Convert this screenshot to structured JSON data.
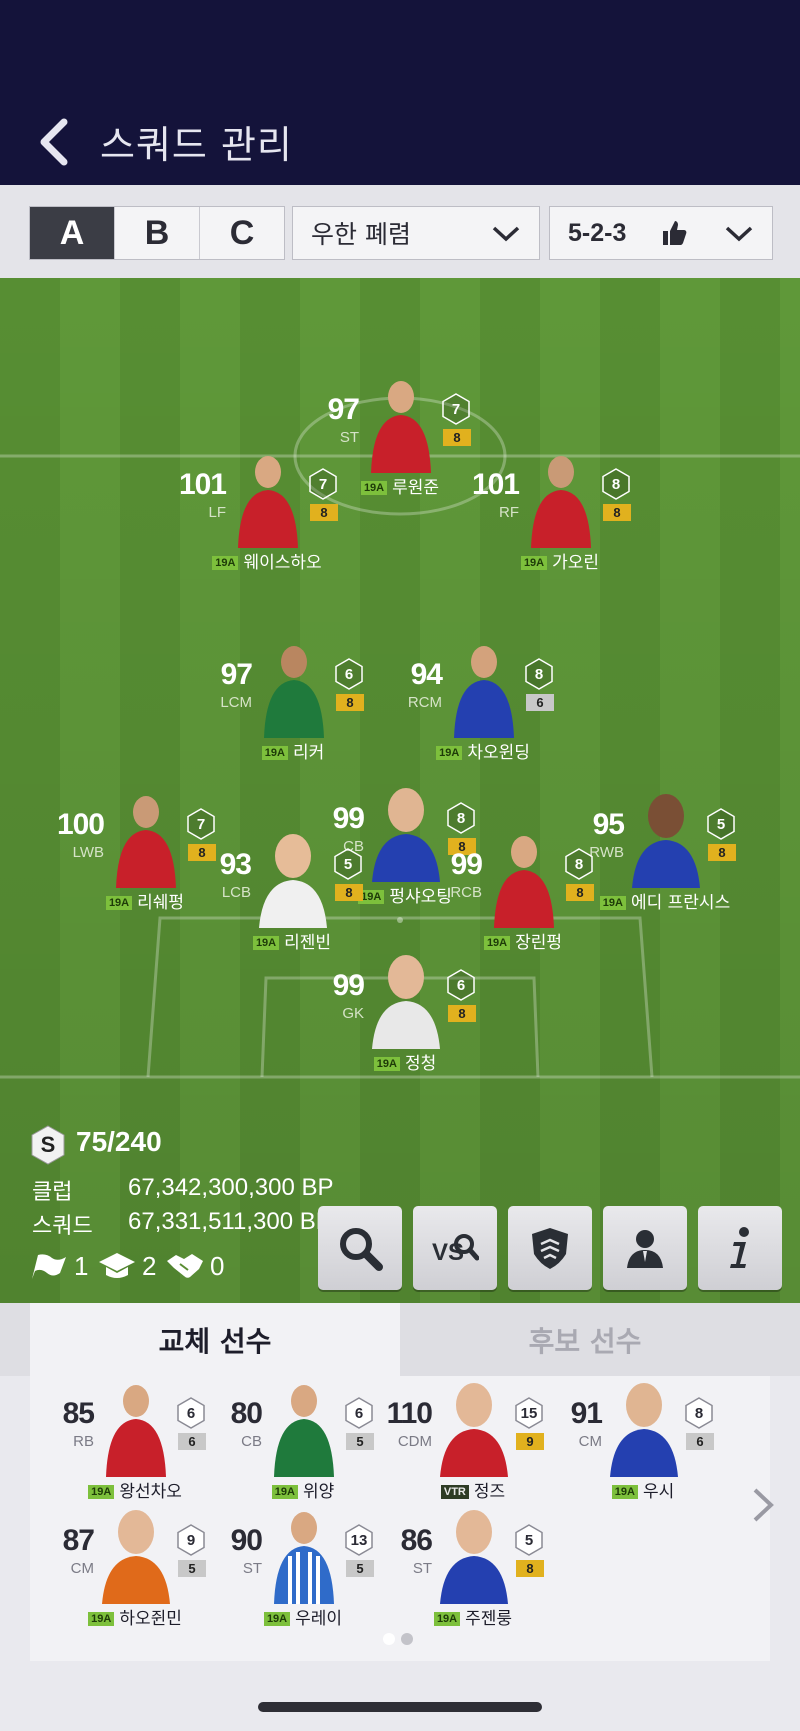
{
  "header": {
    "title": "스쿼드 관리"
  },
  "squad_tabs": [
    "A",
    "B",
    "C"
  ],
  "team_select": {
    "value": "우한 폐렴"
  },
  "formation_select": {
    "value": "5-2-3"
  },
  "colors": {
    "header_bg": "#14133a",
    "pitch": "#5b9436",
    "level_badge": "#e1b11e",
    "season_badge": "#7dc03c"
  },
  "starters": [
    {
      "ovr": "97",
      "pos": "ST",
      "rank": "7",
      "level": "8",
      "badge": "19A",
      "name": "루원준",
      "kit": "#c8202a"
    },
    {
      "ovr": "101",
      "pos": "LF",
      "rank": "7",
      "level": "8",
      "badge": "19A",
      "name": "웨이스하오",
      "kit": "#c8202a"
    },
    {
      "ovr": "101",
      "pos": "RF",
      "rank": "8",
      "level": "8",
      "badge": "19A",
      "name": "가오린",
      "kit": "#c8202a"
    },
    {
      "ovr": "97",
      "pos": "LCM",
      "rank": "6",
      "level": "8",
      "badge": "19A",
      "name": "리커",
      "kit": "#1f7a3c"
    },
    {
      "ovr": "94",
      "pos": "RCM",
      "rank": "8",
      "level": "6",
      "badge": "19A",
      "name": "차오윈딩",
      "kit": "#2440b0"
    },
    {
      "ovr": "100",
      "pos": "LWB",
      "rank": "7",
      "level": "8",
      "badge": "19A",
      "name": "리쉐펑",
      "kit": "#c8202a"
    },
    {
      "ovr": "99",
      "pos": "CB",
      "rank": "8",
      "level": "8",
      "badge": "19A",
      "name": "펑샤오팅",
      "kit": "#2440b0"
    },
    {
      "ovr": "95",
      "pos": "RWB",
      "rank": "5",
      "level": "8",
      "badge": "19A",
      "name": "에디 프란시스",
      "kit": "#2440b0"
    },
    {
      "ovr": "93",
      "pos": "LCB",
      "rank": "5",
      "level": "8",
      "badge": "19A",
      "name": "리젠빈",
      "kit": "#c8202a"
    },
    {
      "ovr": "99",
      "pos": "RCB",
      "rank": "8",
      "level": "8",
      "badge": "19A",
      "name": "장린펑",
      "kit": "#c8202a"
    },
    {
      "ovr": "99",
      "pos": "GK",
      "rank": "6",
      "level": "8",
      "badge": "19A",
      "name": "정청",
      "kit": "#e8e8e8"
    }
  ],
  "squad_stats": {
    "grade": "S",
    "score": "75/240",
    "club_label": "클럽",
    "club_value": "67,342,300,300 BP",
    "squad_label": "스쿼드",
    "squad_value": "67,331,511,300 BP",
    "counts": [
      "1",
      "2",
      "0"
    ]
  },
  "action_icons": [
    "search-icon",
    "vs-search-icon",
    "shield-icon",
    "manager-icon",
    "info-icon"
  ],
  "bottom_tabs": [
    "교체 선수",
    "후보 선수"
  ],
  "subs": [
    {
      "ovr": "85",
      "pos": "RB",
      "rank": "6",
      "level": "6",
      "badge": "19A",
      "name": "왕선차오",
      "kit": "#c8202a"
    },
    {
      "ovr": "80",
      "pos": "CB",
      "rank": "6",
      "level": "5",
      "badge": "19A",
      "name": "위양",
      "kit": "#1f7a3c"
    },
    {
      "ovr": "110",
      "pos": "CDM",
      "rank": "15",
      "level": "9",
      "badge": "VTR",
      "name": "정즈",
      "kit": "#c8202a"
    },
    {
      "ovr": "91",
      "pos": "CM",
      "rank": "8",
      "level": "6",
      "badge": "19A",
      "name": "우시",
      "kit": "#2440b0"
    },
    {
      "ovr": "87",
      "pos": "CM",
      "rank": "9",
      "level": "5",
      "badge": "19A",
      "name": "하오쥔민",
      "kit": "#e06a1a"
    },
    {
      "ovr": "90",
      "pos": "ST",
      "rank": "13",
      "level": "5",
      "badge": "19A",
      "name": "우레이",
      "kit": "#2f6bc9"
    },
    {
      "ovr": "86",
      "pos": "ST",
      "rank": "5",
      "level": "8",
      "badge": "19A",
      "name": "주젠룽",
      "kit": "#2440b0"
    }
  ]
}
